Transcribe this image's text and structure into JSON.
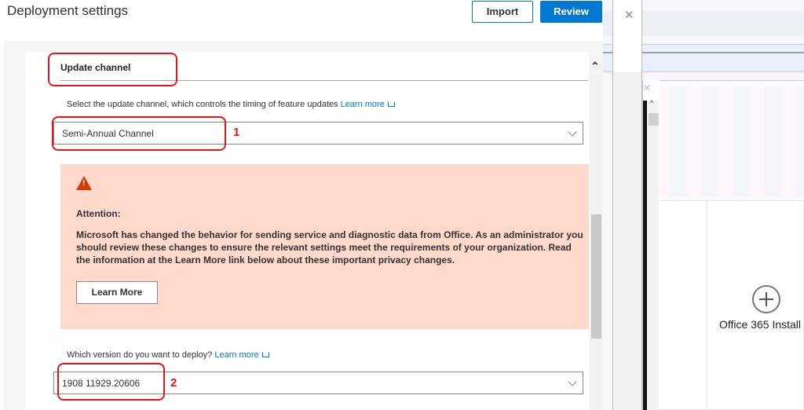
{
  "blade": {
    "title": "Deployment settings",
    "import_label": "Import",
    "review_label": "Review"
  },
  "section": {
    "title": "Update channel"
  },
  "update_channel": {
    "label": "Select the update channel, which controls the timing of feature updates",
    "link_label": "Learn more",
    "value": "Semi-Annual Channel"
  },
  "warning": {
    "heading": "Attention:",
    "body": "Microsoft has changed the behavior for sending service and diagnostic data from Office. As an administrator you should review these changes to ensure the relevant settings meet the requirements of your organization. Read the information at the Learn More link below about these important privacy changes.",
    "button_label": "Learn More",
    "color": "#d83b01",
    "background": "#fed9cc"
  },
  "version": {
    "label": "Which version do you want to deploy?",
    "link_label": "Learn more",
    "value": "1908 11929.20606"
  },
  "annotations": [
    {
      "number": "1"
    },
    {
      "number": "2"
    }
  ],
  "background_app": {
    "card_label": "Office 365 Install"
  },
  "colors": {
    "accent": "#0078d4",
    "annotation": "#e0161c"
  }
}
